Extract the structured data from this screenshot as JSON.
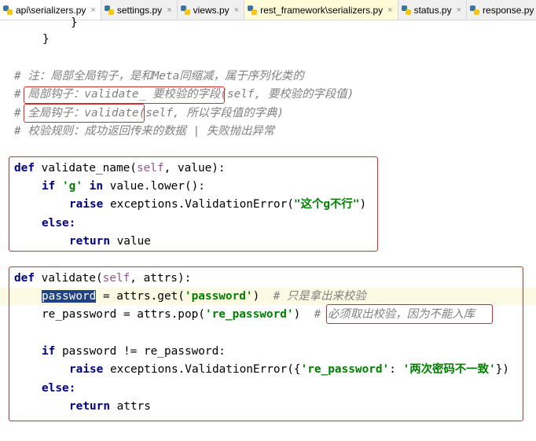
{
  "tabs": [
    {
      "label": "api\\serializers.py",
      "icon": "python-file-icon",
      "state": "active"
    },
    {
      "label": "settings.py",
      "icon": "python-file-icon",
      "state": "normal"
    },
    {
      "label": "views.py",
      "icon": "python-file-icon",
      "state": "normal"
    },
    {
      "label": "rest_framework\\serializers.py",
      "icon": "python-file-icon",
      "state": "highlight"
    },
    {
      "label": "status.py",
      "icon": "python-file-icon",
      "state": "normal"
    },
    {
      "label": "response.py",
      "icon": "python-file-icon",
      "state": "normal"
    }
  ],
  "code": {
    "l1": "}",
    "l2": "}",
    "c1": "# 注：局部全局钩子，是和Meta同缩减，属于序列化类的",
    "c2_prefix": "# ",
    "c2_box": "局部钩子：validate_",
    "c2_rest": "要校验的字段(self, 要校验的字段值)",
    "c3_prefix": "# ",
    "c3_box": "全局钩子：validate",
    "c3_rest": "(self, 所以字段值的字典)",
    "c4": "# 校验规则：成功返回传来的数据 | 失败抛出异常",
    "f1_def": "def",
    "f1_sig_a": " validate_name(",
    "f1_self": "self",
    "f1_sig_b": ", value):",
    "f1_if": "if",
    "f1_str_g": "'g'",
    "f1_in": "in",
    "f1_cond": " value.lower():",
    "f1_raise": "raise",
    "f1_raise_call": " exceptions.ValidationError(",
    "f1_msg": "\"这个g不行\"",
    "f1_close": ")",
    "f1_else": "else:",
    "f1_return": "return",
    "f1_ret_val": " value",
    "f2_def": "def",
    "f2_sig_a": " validate(",
    "f2_self": "self",
    "f2_sig_b": ", attrs):",
    "f2_pw_var": "password",
    "f2_pw_assign": " = attrs.get(",
    "f2_pw_key": "'password'",
    "f2_pw_close": ")  ",
    "f2_pw_cmt": "# 只是拿出来校验",
    "f2_re_assign": "re_password = attrs.pop(",
    "f2_re_key": "'re_password'",
    "f2_re_close": ")  ",
    "f2_re_hash": "# ",
    "f2_re_cmt": "必须取出校验，因为不能入库",
    "f2_if": "if",
    "f2_cond": " password != re_password:",
    "f2_raise": "raise",
    "f2_raise_call": " exceptions.ValidationError({",
    "f2_err_key": "'re_password'",
    "f2_colon": ": ",
    "f2_err_msg": "'两次密码不一致'",
    "f2_err_close": "})",
    "f2_else": "else:",
    "f2_return": "return",
    "f2_ret_val": " attrs"
  }
}
